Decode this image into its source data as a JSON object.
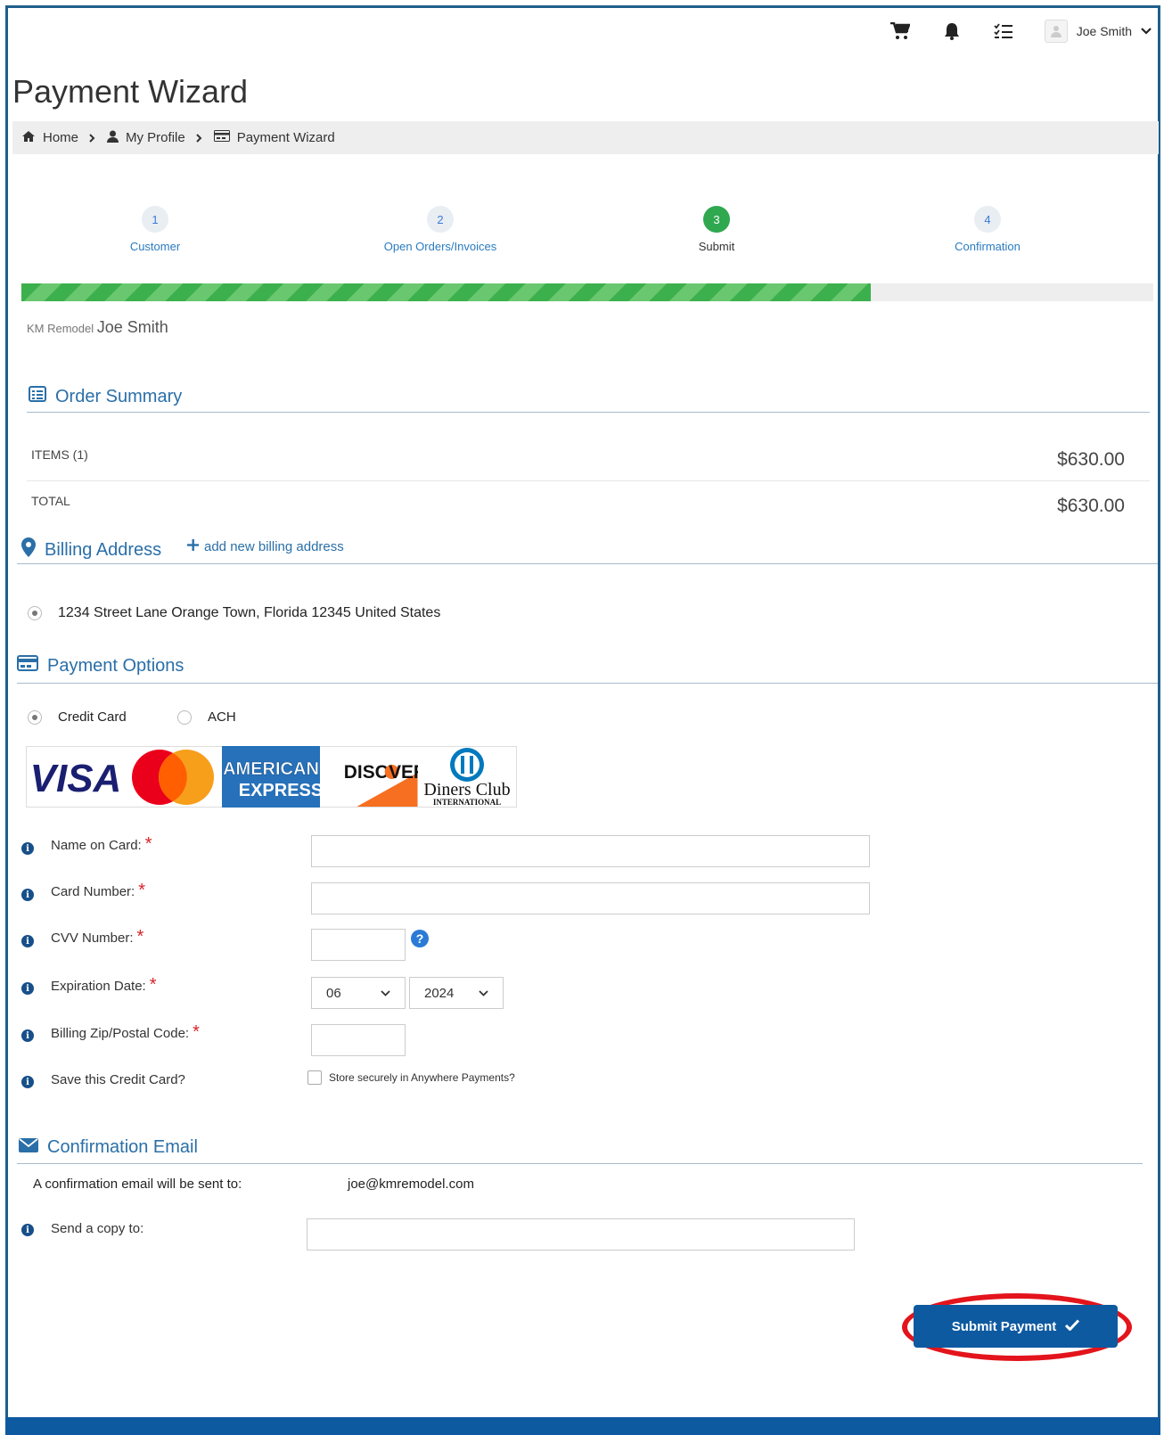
{
  "header": {
    "user_name": "Joe Smith",
    "icons": [
      "cart-icon",
      "bell-icon",
      "tasks-icon"
    ]
  },
  "page": {
    "title": "Payment Wizard"
  },
  "breadcrumb": [
    {
      "label": "Home",
      "icon": "home-icon"
    },
    {
      "label": "My Profile",
      "icon": "user-icon"
    },
    {
      "label": "Payment Wizard",
      "icon": "credit-card-icon"
    }
  ],
  "wizard": {
    "steps": [
      {
        "num": "1",
        "label": "Customer",
        "active": false
      },
      {
        "num": "2",
        "label": "Open Orders/Invoices",
        "active": false
      },
      {
        "num": "3",
        "label": "Submit",
        "active": true
      },
      {
        "num": "4",
        "label": "Confirmation",
        "active": false
      }
    ],
    "progress_percent": 75
  },
  "customer": {
    "company": "KM Remodel",
    "name": "Joe Smith"
  },
  "order_summary": {
    "title": "Order Summary",
    "items_label": "ITEMS (1)",
    "items_value": "$630.00",
    "total_label": "TOTAL",
    "total_value": "$630.00"
  },
  "billing": {
    "title": "Billing Address",
    "add_link": "add new billing address",
    "address": "1234 Street Lane Orange Town, Florida 12345 United States"
  },
  "payment": {
    "title": "Payment Options",
    "option_credit": "Credit Card",
    "option_ach": "ACH",
    "card_brands": [
      "VISA",
      "Mastercard",
      "American Express",
      "DISCOVER",
      "Diners Club International"
    ],
    "fields": {
      "name_label": "Name on Card:",
      "number_label": "Card Number:",
      "cvv_label": "CVV Number:",
      "exp_label": "Expiration Date:",
      "zip_label": "Billing Zip/Postal Code:",
      "save_label": "Save this Credit Card?",
      "required_mark": "*",
      "exp_month": "06",
      "exp_year": "2024",
      "store_label": "Store securely in Anywhere Payments?"
    }
  },
  "confirmation": {
    "title": "Confirmation Email",
    "sent_label": "A confirmation email will be sent to:",
    "email": "joe@kmremodel.com",
    "copy_label": "Send a copy to:"
  },
  "submit": {
    "label": "Submit Payment"
  },
  "colors": {
    "accent": "#2a6fa8",
    "primary_button": "#0e5aa0",
    "progress": "#3cb04c",
    "highlight": "#e3141b"
  }
}
